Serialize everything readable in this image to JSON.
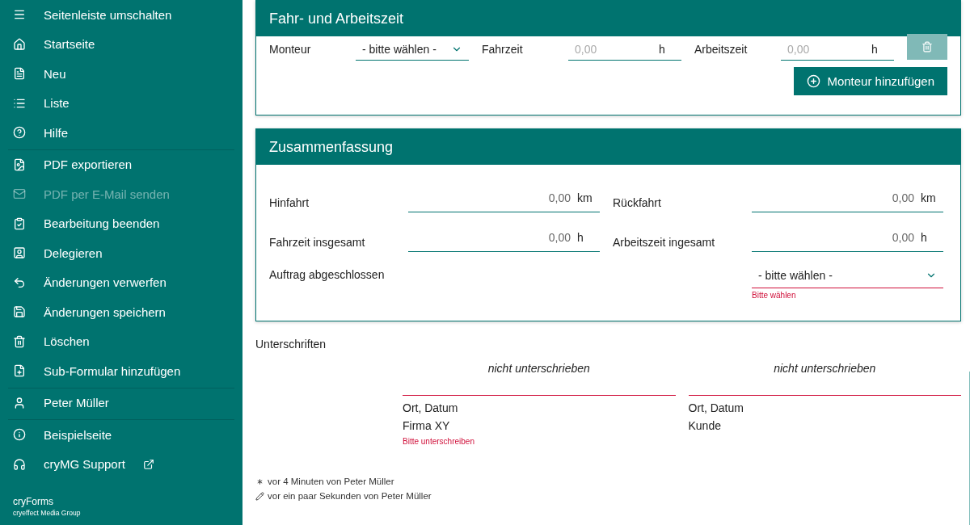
{
  "sidebar": {
    "groups": [
      [
        {
          "label": "Seitenleiste umschalten",
          "disabled": false
        },
        {
          "label": "Startseite",
          "disabled": false
        },
        {
          "label": "Neu",
          "disabled": false
        },
        {
          "label": "Liste",
          "disabled": false
        },
        {
          "label": "Hilfe",
          "disabled": false
        }
      ],
      [
        {
          "label": "PDF exportieren",
          "disabled": false
        },
        {
          "label": "PDF per E-Mail senden",
          "disabled": true
        },
        {
          "label": "Bearbeitung beenden",
          "disabled": false
        },
        {
          "label": "Delegieren",
          "disabled": false
        },
        {
          "label": "Änderungen verwerfen",
          "disabled": false
        },
        {
          "label": "Änderungen speichern",
          "disabled": false
        },
        {
          "label": "Löschen",
          "disabled": false
        },
        {
          "label": "Sub-Formular hinzufügen",
          "disabled": false
        }
      ],
      [
        {
          "label": "Peter Müller",
          "disabled": false
        }
      ],
      [
        {
          "label": "Beispielseite",
          "disabled": false,
          "external": false
        },
        {
          "label": "cryMG Support",
          "disabled": false,
          "external": true
        }
      ]
    ],
    "footer": {
      "app": "cryForms",
      "company": "cryeffect Media Group"
    }
  },
  "work_card": {
    "title": "Fahr- und Arbeitszeit",
    "row": {
      "worker_label": "Monteur",
      "worker_select": "- bitte wählen -",
      "travel_label": "Fahrzeit",
      "travel_placeholder": "0,00",
      "travel_unit": "h",
      "work_label": "Arbeitszeit",
      "work_placeholder": "0,00",
      "work_unit": "h",
      "delete_disabled": true
    },
    "add_button": "Monteur hinzufügen"
  },
  "summary_card": {
    "title": "Zusammenfassung",
    "fields": [
      {
        "label": "Hinfahrt",
        "value": "0,00",
        "unit": "km"
      },
      {
        "label": "Rückfahrt",
        "value": "0,00",
        "unit": "km"
      },
      {
        "label": "Fahrzeit insgesamt",
        "value": "0,00",
        "unit": "h"
      },
      {
        "label": "Arbeitszeit ingesamt",
        "value": "0,00",
        "unit": "h"
      }
    ],
    "completed": {
      "label": "Auftrag abgeschlossen",
      "value": "- bitte wählen -",
      "error": "Bitte wählen"
    }
  },
  "signatures": {
    "title": "Unterschriften",
    "items": [
      {
        "status": "nicht unterschrieben",
        "place_date": "Ort, Datum",
        "name": "Firma XY",
        "error": "Bitte unterschreiben"
      },
      {
        "status": "nicht unterschrieben",
        "place_date": "Ort, Datum",
        "name": "Kunde"
      }
    ]
  },
  "history": [
    {
      "kind": "created",
      "text": "vor 4 Minuten von Peter Müller"
    },
    {
      "kind": "edited",
      "text": "vor ein paar Sekunden von Peter Müller"
    }
  ]
}
